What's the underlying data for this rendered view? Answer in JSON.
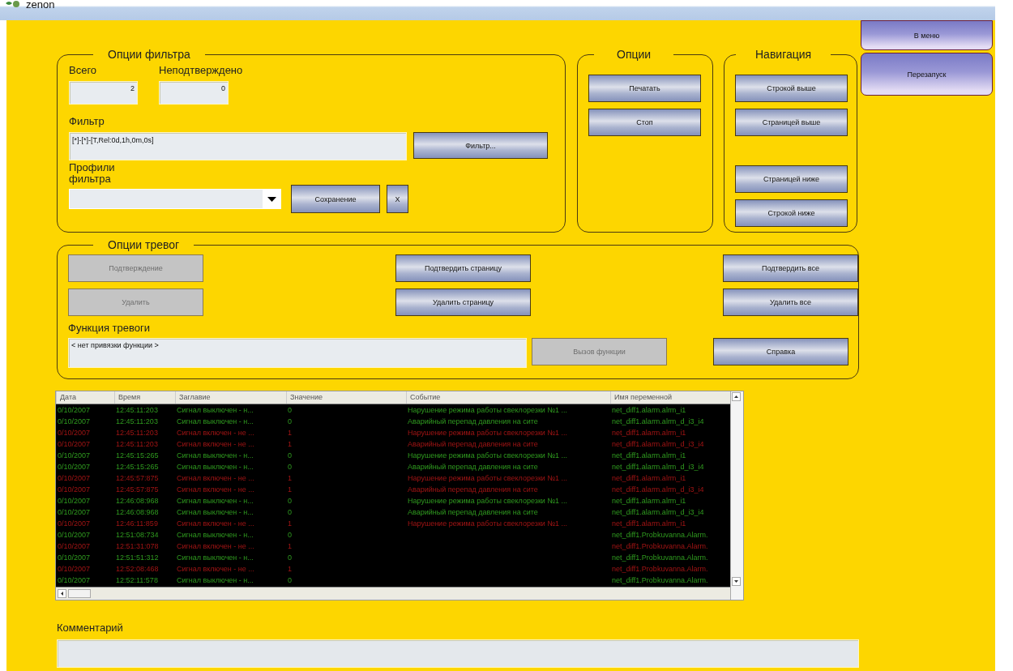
{
  "window": {
    "title": "zenon"
  },
  "side_buttons": [
    {
      "label": "В меню"
    },
    {
      "label": "Перезапуск"
    }
  ],
  "filter_options": {
    "title": "Опции фильтра",
    "total": {
      "label": "Всего",
      "value": "2"
    },
    "unacknowledged": {
      "label": "Неподтверждено",
      "value": "0"
    },
    "filter": {
      "label": "Фильтр",
      "value": "[*]-[*]-[T,Rel:0d,1h,0m,0s]",
      "button": "Фильтр..."
    },
    "profiles": {
      "label": "Профили фильтра",
      "save_button": "Сохранение",
      "delete_button": "X"
    }
  },
  "options": {
    "title": "Опции",
    "buttons": [
      "Печатать",
      "Стоп"
    ]
  },
  "navigation": {
    "title": "Навигация",
    "buttons": [
      "Строкой выше",
      "Страницей выше",
      "Страницей ниже",
      "Строкой ниже"
    ]
  },
  "alarm_options": {
    "title": "Опции тревог",
    "buttons": [
      {
        "label": "Подтверждение",
        "disabled": true
      },
      {
        "label": "Подтвердить страницу",
        "disabled": false
      },
      {
        "label": "Подтвердить все",
        "disabled": false
      },
      {
        "label": "Удалить",
        "disabled": true
      },
      {
        "label": "Удалить страницу",
        "disabled": false
      },
      {
        "label": "Удалить все",
        "disabled": false
      }
    ],
    "function": {
      "label": "Функция тревоги",
      "value": "< нет привязки функции >",
      "button": {
        "label": "Вызов функции",
        "disabled": true
      }
    },
    "help_button": "Справка"
  },
  "alarm_table": {
    "columns": [
      "Дата",
      "Время",
      "Заглавие",
      "Значение",
      "Событие",
      "Имя переменной"
    ],
    "rows": [
      {
        "active": false,
        "cells": {
          "date": "0/10/2007",
          "time": "12:45:11:203",
          "title": "Сигнал выключен - н...",
          "value": "0",
          "event": "Нарушение режима работы свеклорезки №1 ...",
          "variable": "net_diff1.alarm.alrm_i1"
        }
      },
      {
        "active": false,
        "cells": {
          "date": "0/10/2007",
          "time": "12:45:11:203",
          "title": "Сигнал выключен - н...",
          "value": "0",
          "event": "Аварийный перепад давления на сите",
          "variable": "net_diff1.alarm.alrm_d_i3_i4"
        }
      },
      {
        "active": true,
        "cells": {
          "date": "0/10/2007",
          "time": "12:45:11:203",
          "title": "Сигнал включен - не ...",
          "value": "1",
          "event": "Нарушение режима работы свеклорезки №1 ...",
          "variable": "net_diff1.alarm.alrm_i1"
        }
      },
      {
        "active": true,
        "cells": {
          "date": "0/10/2007",
          "time": "12:45:11:203",
          "title": "Сигнал включен - не ...",
          "value": "1",
          "event": "Аварийный перепад давления на сите",
          "variable": "net_diff1.alarm.alrm_d_i3_i4"
        }
      },
      {
        "active": false,
        "cells": {
          "date": "0/10/2007",
          "time": "12:45:15:265",
          "title": "Сигнал выключен - н...",
          "value": "0",
          "event": "Нарушение режима работы свеклорезки №1 ...",
          "variable": "net_diff1.alarm.alrm_i1"
        }
      },
      {
        "active": false,
        "cells": {
          "date": "0/10/2007",
          "time": "12:45:15:265",
          "title": "Сигнал выключен - н...",
          "value": "0",
          "event": "Аварийный перепад давления на сите",
          "variable": "net_diff1.alarm.alrm_d_i3_i4"
        }
      },
      {
        "active": true,
        "cells": {
          "date": "0/10/2007",
          "time": "12:45:57:875",
          "title": "Сигнал включен - не ...",
          "value": "1",
          "event": "Нарушение режима работы свеклорезки №1 ...",
          "variable": "net_diff1.alarm.alrm_i1"
        }
      },
      {
        "active": true,
        "cells": {
          "date": "0/10/2007",
          "time": "12:45:57:875",
          "title": "Сигнал включен - не ...",
          "value": "1",
          "event": "Аварийный перепад давления на сите",
          "variable": "net_diff1.alarm.alrm_d_i3_i4"
        }
      },
      {
        "active": false,
        "cells": {
          "date": "0/10/2007",
          "time": "12:46:08:968",
          "title": "Сигнал выключен - н...",
          "value": "0",
          "event": "Нарушение режима работы свеклорезки №1 ...",
          "variable": "net_diff1.alarm.alrm_i1"
        }
      },
      {
        "active": false,
        "cells": {
          "date": "0/10/2007",
          "time": "12:46:08:968",
          "title": "Сигнал выключен - н...",
          "value": "0",
          "event": "Аварийный перепад давления на сите",
          "variable": "net_diff1.alarm.alrm_d_i3_i4"
        }
      },
      {
        "active": true,
        "cells": {
          "date": "0/10/2007",
          "time": "12:46:11:859",
          "title": "Сигнал включен - не ...",
          "value": "1",
          "event": "Нарушение режима работы свеклорезки №1 ...",
          "variable": "net_diff1.alarm.alrm_i1"
        }
      },
      {
        "active": false,
        "cells": {
          "date": "0/10/2007",
          "time": "12:51:08:734",
          "title": "Сигнал выключен - н...",
          "value": "0",
          "variable": "net_diff1.Probkuvanna.Alarm."
        }
      },
      {
        "active": true,
        "cells": {
          "date": "0/10/2007",
          "time": "12:51:31:078",
          "title": "Сигнал включен - не ...",
          "value": "1",
          "variable": "net_diff1.Probkuvanna.Alarm."
        }
      },
      {
        "active": false,
        "cells": {
          "date": "0/10/2007",
          "time": "12:51:51:312",
          "title": "Сигнал выключен - н...",
          "value": "0",
          "variable": "net_diff1.Probkuvanna.Alarm."
        }
      },
      {
        "active": true,
        "cells": {
          "date": "0/10/2007",
          "time": "12:52:08:468",
          "title": "Сигнал включен - не ...",
          "value": "1",
          "variable": "net_diff1.Probkuvanna.Alarm."
        }
      },
      {
        "active": false,
        "cells": {
          "date": "0/10/2007",
          "time": "12:52:11:578",
          "title": "Сигнал выключен - н...",
          "value": "0",
          "variable": "net_diff1.Probkuvanna.Alarm."
        }
      }
    ]
  },
  "comment": {
    "label": "Комментарий"
  }
}
